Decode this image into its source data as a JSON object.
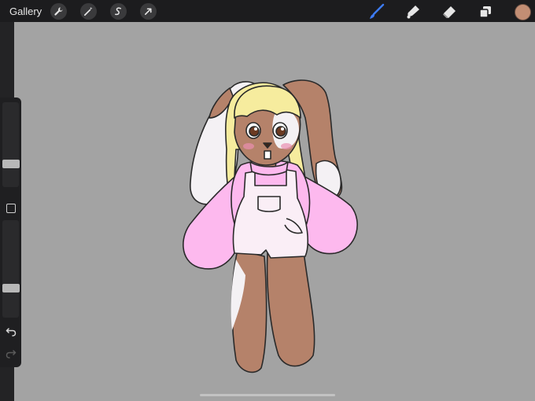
{
  "topbar": {
    "gallery_label": "Gallery",
    "left_tools": [
      "wrench-icon",
      "magic-wand-icon",
      "selection-icon",
      "transform-arrow-icon"
    ],
    "right_tools": [
      "brush-icon",
      "smudge-icon",
      "eraser-icon",
      "layers-icon"
    ],
    "active_tool": "brush-icon",
    "active_color": "#c28e74",
    "accent": "#3d7bf7"
  },
  "sidebar": {
    "brush_size_level": 0.25,
    "opacity_level": 0.28
  },
  "canvas": {
    "background": "#a3a3a3"
  }
}
